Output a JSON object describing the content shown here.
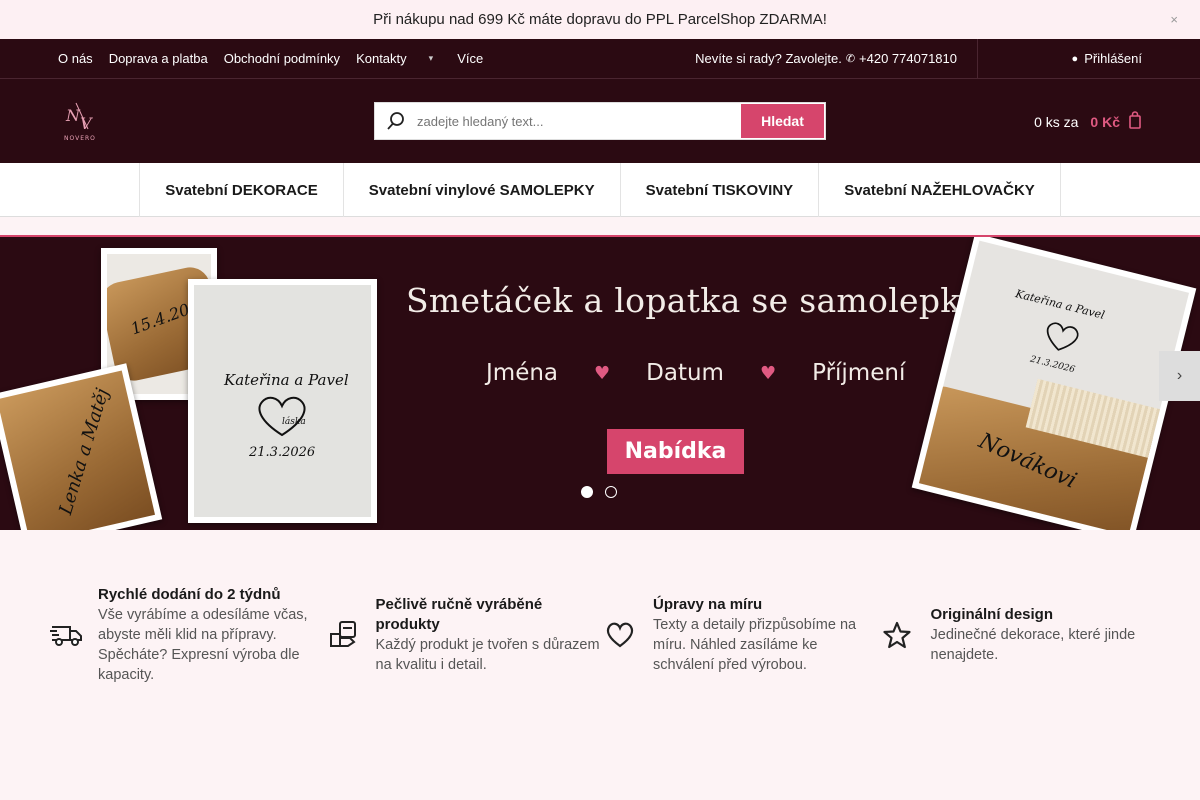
{
  "promo": {
    "text": "Při nákupu nad 699 Kč máte dopravu do PPL ParcelShop ZDARMA!",
    "close_icon": "×"
  },
  "topnav": {
    "links": [
      "O nás",
      "Doprava a platba",
      "Obchodní podmínky",
      "Kontakty"
    ],
    "more_label": "Více",
    "help_text": "Nevíte si rady? Zavolejte.",
    "phone": "+420 774071810",
    "login_label": "Přihlášení"
  },
  "header": {
    "logo_text": "NOVERO",
    "search": {
      "placeholder": "zadejte hledaný text...",
      "button_label": "Hledat"
    },
    "cart": {
      "count": "0 ks za",
      "price": "0 Kč"
    }
  },
  "mainnav": {
    "items": [
      "Svatební DEKORACE",
      "Svatební vinylové SAMOLEPKY",
      "Svatební TISKOVINY",
      "Svatební NAŽEHLOVAČKY"
    ]
  },
  "hero": {
    "title": "Smetáček a lopatka se samolepkou",
    "tags": [
      "Jména",
      "Datum",
      "Příjmení"
    ],
    "cta_label": "Nabídka",
    "photo_texts": {
      "date1": "15.4.2026",
      "names1": "Lenka a Matěj",
      "names2": "Kateřina a Pavel",
      "heart_text": "láska",
      "date2": "21.3.2026",
      "surname": "Novákovi"
    },
    "active_slide": 1,
    "slide_count": 2
  },
  "features": [
    {
      "icon": "truck-icon",
      "title": "Rychlé dodání do 2 týdnů",
      "desc": "Vše vyrábíme a odesíláme včas, abyste měli klid na přípravy. Spěcháte? Expresní výroba dle kapacity."
    },
    {
      "icon": "handmade-icon",
      "title": "Pečlivě ručně vyráběné produkty",
      "desc": "Každý produkt je tvořen s důrazem na kvalitu i detail."
    },
    {
      "icon": "heart-icon",
      "title": "Úpravy na míru",
      "desc": "Texty a detaily přizpůsobíme na míru. Náhled zasíláme ke schválení před výrobou."
    },
    {
      "icon": "star-icon",
      "title": "Originální design",
      "desc": "Jedinečné dekorace, které jinde nenajdete."
    }
  ],
  "colors": {
    "dark": "#2b0a12",
    "accent": "#d6456c",
    "bg": "#fdf3f5"
  }
}
